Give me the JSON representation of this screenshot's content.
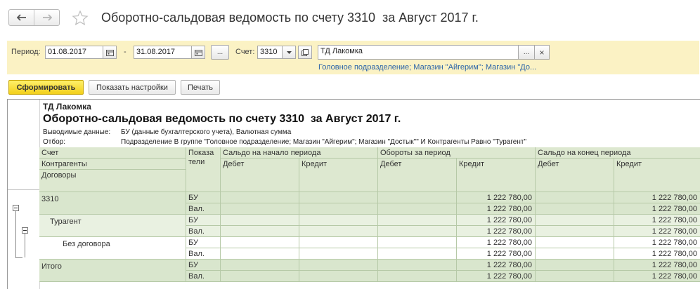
{
  "header": {
    "title": "Оборотно-сальдовая ведомость по счету 3310  за Август 2017 г."
  },
  "filters": {
    "period_label": "Период:",
    "date_from": "01.08.2017",
    "dash": "-",
    "date_to": "31.08.2017",
    "ellipsis": "...",
    "account_label": "Счет:",
    "account": "3310",
    "organization": "ТД Лакомка",
    "clear": "×",
    "selection_link": "Головное подразделение; Магазин \"Айгерим\"; Магазин \"До..."
  },
  "toolbar": {
    "generate": "Сформировать",
    "settings": "Показать настройки",
    "print": "Печать"
  },
  "report": {
    "org": "ТД Лакомка",
    "title": "Оборотно-сальдовая ведомость по счету 3310  за Август 2017 г.",
    "output_label": "Выводимые данные:",
    "output_value": "БУ (данные бухгалтерского учета), Валютная сумма",
    "filter_label": "Отбор:",
    "filter_value": "Подразделение В группе \"Головное подразделение; Магазин \"Айгерим\"; Магазин \"Достык\"\" И Контрагенты Равно \"Турагент\"",
    "columns": {
      "account": "Счет",
      "contractors": "Контрагенты",
      "contracts": "Договоры",
      "indicators": "Показа\nтели",
      "opening": "Сальдо на начало периода",
      "turnover": "Обороты за период",
      "closing": "Сальдо на конец периода",
      "debit": "Дебет",
      "credit": "Кредит"
    },
    "rows": [
      {
        "name": "3310",
        "level": 1,
        "ind": [
          "БУ",
          "Вал."
        ],
        "turnover_credit": [
          "1 222 780,00",
          "1 222 780,00"
        ],
        "closing_credit": [
          "1 222 780,00",
          "1 222 780,00"
        ]
      },
      {
        "name": "Турагент",
        "level": 2,
        "ind": [
          "БУ",
          "Вал."
        ],
        "turnover_credit": [
          "1 222 780,00",
          "1 222 780,00"
        ],
        "closing_credit": [
          "1 222 780,00",
          "1 222 780,00"
        ]
      },
      {
        "name": "Без договора",
        "level": 3,
        "ind": [
          "БУ",
          "Вал."
        ],
        "turnover_credit": [
          "1 222 780,00",
          "1 222 780,00"
        ],
        "closing_credit": [
          "1 222 780,00",
          "1 222 780,00"
        ]
      },
      {
        "name": "Итого",
        "level": 1,
        "ind": [
          "БУ",
          "Вал."
        ],
        "turnover_credit": [
          "1 222 780,00",
          "1 222 780,00"
        ],
        "closing_credit": [
          "1 222 780,00",
          "1 222 780,00"
        ]
      }
    ]
  },
  "colors": {
    "accent_yellow": "#f2cf1a",
    "panel_bg": "#fbf2c4",
    "link": "#2a63a8",
    "row_level1": "#d9e6cd",
    "row_level2": "#e9f1e1",
    "row_level3": "#ffffff",
    "header_bg": "#dde8d0"
  },
  "icons": {
    "back": "arrow-left-icon",
    "forward": "arrow-right-icon",
    "favorite": "star-icon",
    "calendar": "calendar-icon",
    "dropdown": "chevron-down-icon",
    "open": "open-window-icon",
    "collapse": "collapse-icon"
  }
}
